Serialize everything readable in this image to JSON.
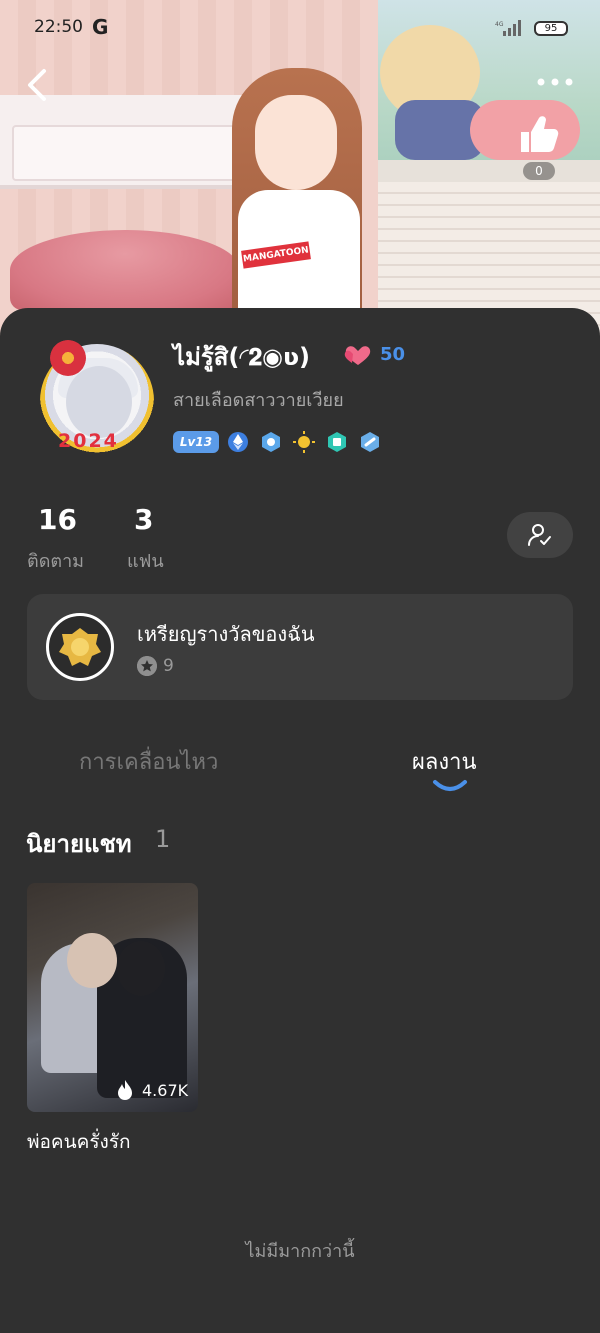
{
  "status_bar": {
    "time": "22:50",
    "google": "G",
    "network": "4G",
    "battery": "95"
  },
  "header": {
    "like_count": "0",
    "shirt_text": "MANGATOON"
  },
  "profile": {
    "avatar_year": "2024",
    "username": "ไม่รู้สิ(◜𝟐◉ʋ)",
    "hearts": "50",
    "bio": "สายเลือดสาววายเวียย",
    "level": "Lv13"
  },
  "stats": {
    "following_count": "16",
    "following_label": "ติดตาม",
    "fans_count": "3",
    "fans_label": "แฟน"
  },
  "medals": {
    "title": "เหรียญรางวัลของฉัน",
    "count": "9"
  },
  "tabs": [
    {
      "label": "การเคลื่อนไหว",
      "active": false
    },
    {
      "label": "ผลงาน",
      "active": true
    }
  ],
  "section": {
    "title": "นิยายแชท",
    "count": "1"
  },
  "works": [
    {
      "title": "พ่อคนครั่งรัก",
      "views": "4.67K"
    }
  ],
  "footer": {
    "end_text": "ไม่มีมากกว่านี้"
  },
  "colors": {
    "accent": "#4a90e8",
    "background": "#303030",
    "card": "#3c3c3c"
  }
}
